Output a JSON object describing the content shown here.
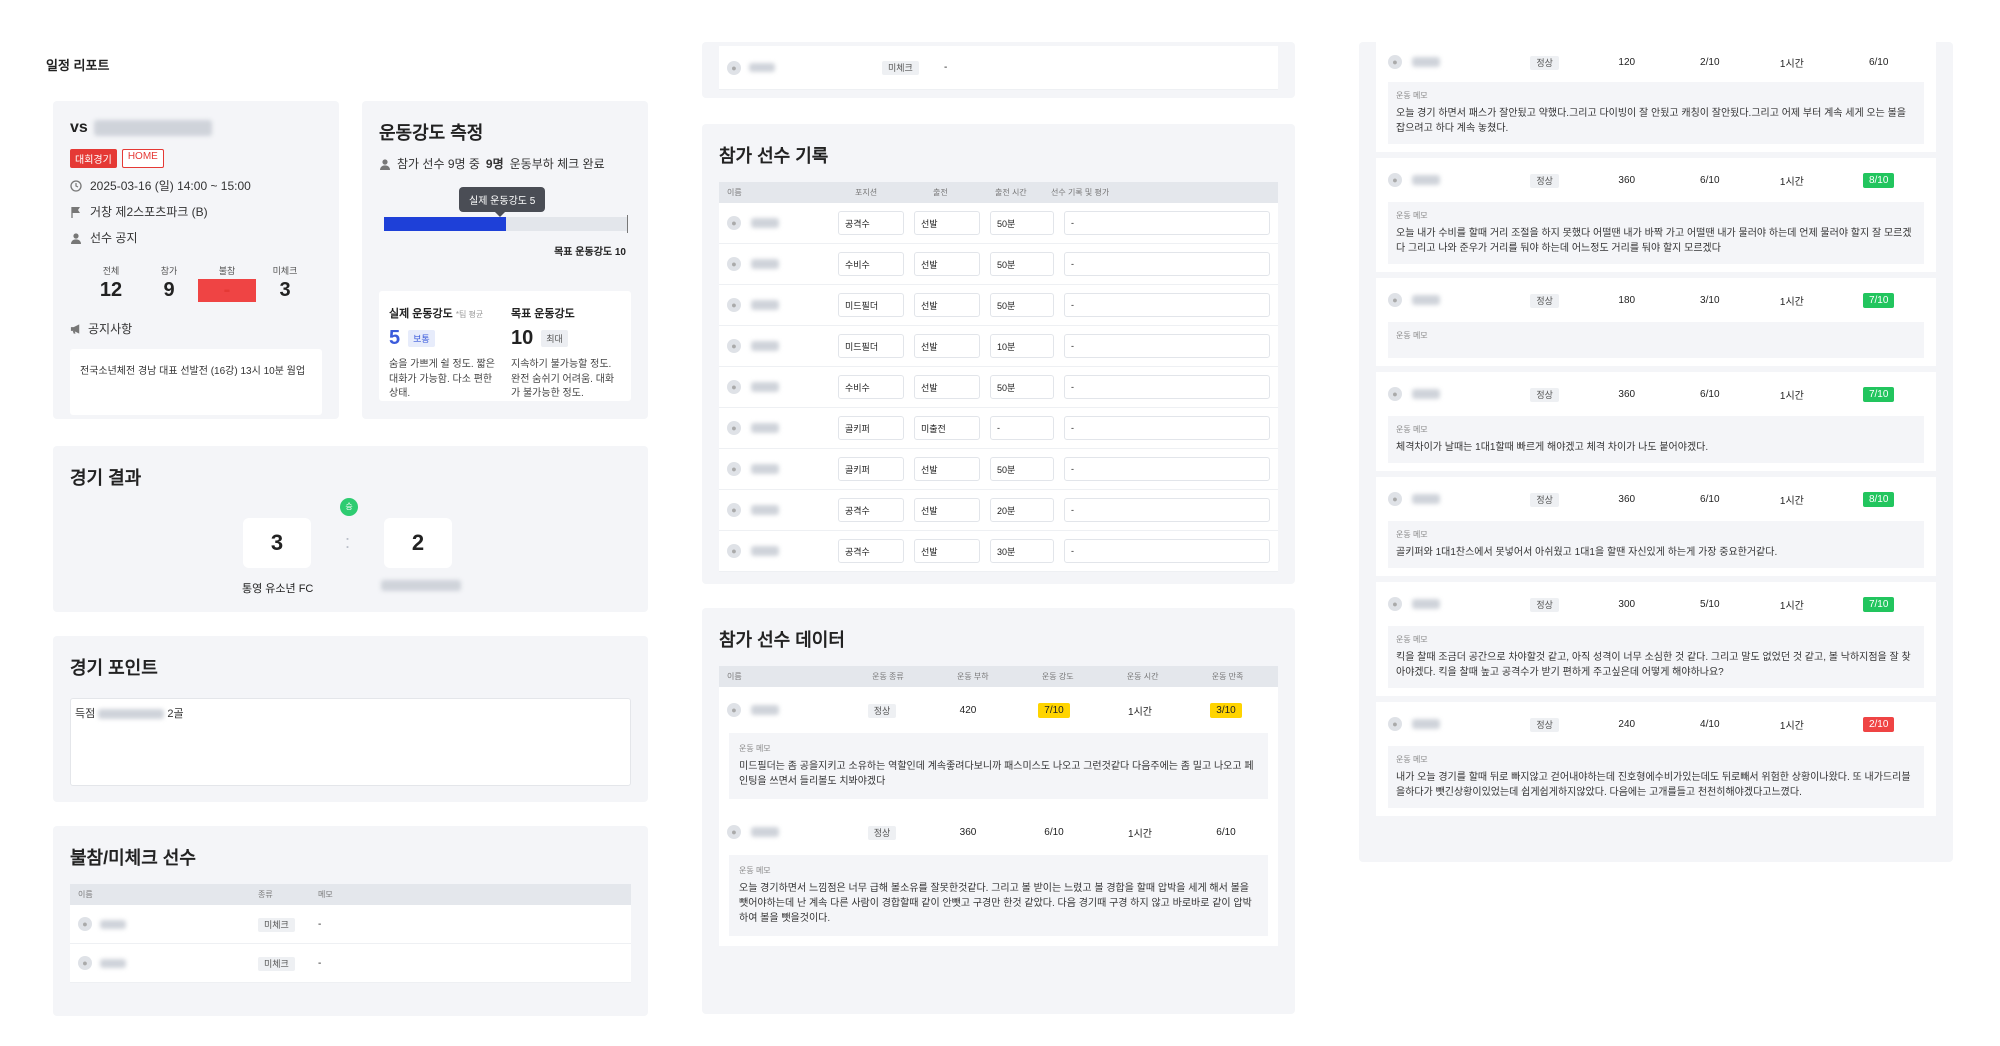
{
  "page": {
    "title": "일정 리포트"
  },
  "match": {
    "vs": "vs",
    "badge_type": "대회경기",
    "badge_home": "HOME",
    "datetime": "2025-03-16 (일) 14:00 ~ 15:00",
    "location": "거창 제2스포츠파크 (B)",
    "visibility": "선수 공지",
    "counts": [
      {
        "label": "전체",
        "value": "12"
      },
      {
        "label": "참가",
        "value": "9"
      },
      {
        "label": "불참",
        "value": "-"
      },
      {
        "label": "미체크",
        "value": "3"
      }
    ],
    "notice_label": "공지사항",
    "notice_text": "전국소년체전 경남 대표 선발전 (16강) 13시 10분 웜업"
  },
  "intensity": {
    "title": "운동강도 측정",
    "summary_pre": "참가 선수 9명 중",
    "summary_bold": "9명",
    "summary_post": "운동부하 체크 완료",
    "tooltip": "실제 운동강도 5",
    "actual_value": 5,
    "max_value": 10,
    "target_label": "목표 운동강도 10",
    "actual_title": "실제 운동강도",
    "actual_note": "*팀 평균",
    "actual_num": "5",
    "actual_tag": "보통",
    "actual_desc": "숨을 가쁘게 쉴 정도. 짧은 대화가 가능함. 다소 편한 상태.",
    "target_title": "목표 운동강도",
    "target_num": "10",
    "target_tag": "최대",
    "target_desc": "지속하기 불가능할 정도. 완전 숨쉬기 어려움. 대화가 불가능한 정도."
  },
  "result": {
    "title": "경기 결과",
    "win_badge": "승",
    "home_score": "3",
    "away_score": "2",
    "separator": ":",
    "home_team": "통영 유소년 FC"
  },
  "points": {
    "title": "경기 포인트",
    "text_pre": "득점",
    "text_post": "2골"
  },
  "absent": {
    "title": "불참/미체크 선수",
    "headers": [
      "이름",
      "종류",
      "메모"
    ],
    "rows": [
      {
        "type": "미체크",
        "memo": "-"
      },
      {
        "type": "미체크",
        "memo": "-"
      }
    ],
    "top_row": {
      "type": "미체크",
      "memo": "-"
    }
  },
  "records": {
    "title": "참가 선수 기록",
    "headers": [
      "이름",
      "포지션",
      "출전",
      "출전 시간",
      "선수 기록 및 평가"
    ],
    "rows": [
      {
        "position": "공격수",
        "start": "선발",
        "time": "50분",
        "note": "-"
      },
      {
        "position": "수비수",
        "start": "선발",
        "time": "50분",
        "note": "-"
      },
      {
        "position": "미드필더",
        "start": "선발",
        "time": "50분",
        "note": "-"
      },
      {
        "position": "미드필더",
        "start": "선발",
        "time": "10분",
        "note": "-"
      },
      {
        "position": "수비수",
        "start": "선발",
        "time": "50분",
        "note": "-"
      },
      {
        "position": "골키퍼",
        "start": "미출전",
        "time": "-",
        "note": "-"
      },
      {
        "position": "골키퍼",
        "start": "선발",
        "time": "50분",
        "note": "-"
      },
      {
        "position": "공격수",
        "start": "선발",
        "time": "20분",
        "note": "-"
      },
      {
        "position": "공격수",
        "start": "선발",
        "time": "30분",
        "note": "-"
      }
    ]
  },
  "player_data": {
    "title": "참가 선수 데이터",
    "headers": [
      "이름",
      "운동 종류",
      "운동 부하",
      "운동 강도",
      "운동 시간",
      "운동 만족"
    ],
    "memo_label": "운동 메모",
    "rows": [
      {
        "kind": "정상",
        "load": "420",
        "intensity": "7/10",
        "intensity_style": "yellow",
        "time": "1시간",
        "satisfaction": "3/10",
        "sat_style": "yellow",
        "memo": "미드필더는 좀 공을지키고 소유하는 역할인데 계속좋려다보니까 패스미스도 나오고 그런것같다 다음주에는 좀 밀고 나오고 페인팅을 쓰면서 들리볼도 치봐야겠다"
      },
      {
        "kind": "정상",
        "load": "360",
        "intensity": "6/10",
        "intensity_style": "plain",
        "time": "1시간",
        "satisfaction": "6/10",
        "sat_style": "plain",
        "memo": "오늘 경기하면서 느낌점은 너무 급해 볼소유를 잘못한것같다. 그리고 볼 받이는 느렸고 볼 경합을 할때 압박을 세게 해서 볼을 뺏어야하는데 난 계속 다른 사람이 경합할때 같이 안뺏고 구경만 한것 같았다. 다음 경기때 구경 하지 않고 바로바로 같이 압박하여 볼을 뺏을것이다."
      }
    ]
  },
  "col3": {
    "memo_label": "운동 메모",
    "top_row": {
      "kind": "정상",
      "load": "120",
      "intensity": "2/10",
      "time": "1시간",
      "satisfaction": "6/10",
      "sat_style": "plain",
      "memo": "오늘 경기 하면서 패스가 잘안됬고 약했다.그리고 다이빙이 잘 안됬고 캐칭이 잘안됬다.그리고 어제 부터 계속 세게 오는 볼을 잡으려고 하다 계속 놓쳤다."
    },
    "rows": [
      {
        "kind": "정상",
        "load": "360",
        "intensity": "6/10",
        "time": "1시간",
        "satisfaction": "8/10",
        "sat_style": "green",
        "memo": "오늘 내가 수비를 할때 거리 조절을 하지 못했다 어떨땐 내가 바짝 가고 어떨땐 내가 물러야 하는데 언제 물러야 할지 잘 모르겠다 그리고 나와 준우가 거리를 둬야 하는데 어느정도 거리를 둬야 할지 모르겠다"
      },
      {
        "kind": "정상",
        "load": "180",
        "intensity": "3/10",
        "time": "1시간",
        "satisfaction": "7/10",
        "sat_style": "green",
        "memo": ""
      },
      {
        "kind": "정상",
        "load": "360",
        "intensity": "6/10",
        "time": "1시간",
        "satisfaction": "7/10",
        "sat_style": "green",
        "memo": "체격차이가 날때는 1대1할때 빠르게 해야겠고 체격 차이가 나도 붙어야겠다."
      },
      {
        "kind": "정상",
        "load": "360",
        "intensity": "6/10",
        "time": "1시간",
        "satisfaction": "8/10",
        "sat_style": "green",
        "memo": "골키퍼와 1대1찬스에서 못넣어서 아쉬웠고 1대1을 할땐 자신있게 하는게 가장 중요한거같다."
      },
      {
        "kind": "정상",
        "load": "300",
        "intensity": "5/10",
        "time": "1시간",
        "satisfaction": "7/10",
        "sat_style": "green",
        "memo": "킥을 찰때 조금더 공간으로 차야할것 같고, 아직 성격이 너무 소심한 것 같다. 그리고 말도 없었던 것 같고, 볼 낙하지점을 잘 찾아야겠다. 킥을 찰때 높고 공격수가 받기 편하게 주고싶은데 어떻게 해야하나요?"
      },
      {
        "kind": "정상",
        "load": "240",
        "intensity": "4/10",
        "time": "1시간",
        "satisfaction": "2/10",
        "sat_style": "red",
        "memo": "내가 오늘 경기를 할때 뒤로 빠지않고 걷어내야하는데 진호형에수비가있는데도 뒤로빼서 위험한 상황이나왔다. 또 내가드리블을하다가 뺏긴상황이있었는데 쉽게쉽게하지않았다. 다음에는 고개를들고 천천히해야겠다고느꼈다."
      }
    ]
  }
}
